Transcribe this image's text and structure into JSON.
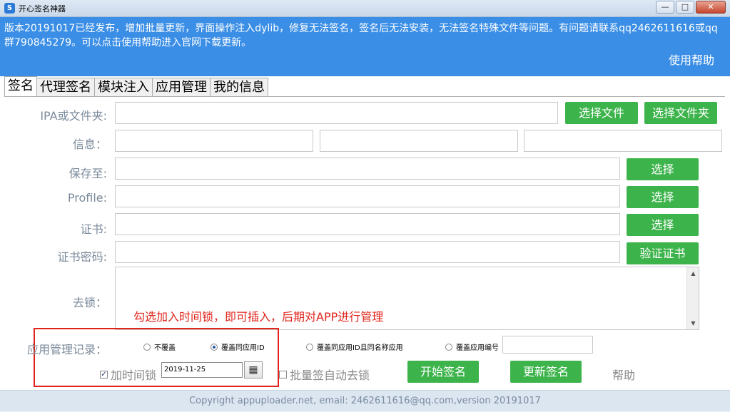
{
  "window": {
    "title": "开心签名神器",
    "icon_name": "app-icon",
    "minimize_glyph": "—",
    "maximize_glyph": "□",
    "close_glyph": "✕"
  },
  "notice": {
    "text": "版本20191017已经发布，增加批量更新，界面操作注入dylib，修复无法签名，签名后无法安装，无法签名特殊文件等问题。有问题请联系qq2462611616或qq群790845279。可以点击使用帮助进入官网下载更新。",
    "help_label": "使用帮助"
  },
  "tabs": [
    {
      "label": "签名",
      "active": true
    },
    {
      "label": "代理签名",
      "active": false
    },
    {
      "label": "模块注入",
      "active": false
    },
    {
      "label": "应用管理",
      "active": false
    },
    {
      "label": "我的信息",
      "active": false
    }
  ],
  "form": {
    "ipa_label": "IPA或文件夹:",
    "select_file_button": "选择文件",
    "select_folder_button": "选择文件夹",
    "info_label": "信息：",
    "save_label": "保存至:",
    "save_select_button": "选择",
    "profile_label": "Profile:",
    "profile_select_button": "选择",
    "cert_label": "证书:",
    "cert_select_button": "选择",
    "cert_password_label": "证书密码:",
    "verify_cert_button": "验证证书",
    "remove_lock_label": "去锁："
  },
  "annotation": {
    "red_note": "勾选加入时间锁，即可插入，后期对APP进行管理"
  },
  "app_record": {
    "label": "应用管理记录：",
    "options": [
      {
        "label": "不覆盖",
        "selected": false
      },
      {
        "label": "覆盖同应用ID",
        "selected": true
      },
      {
        "label": "覆盖同应用ID且同名称应用",
        "selected": false
      },
      {
        "label": "覆盖应用编号",
        "selected": false
      }
    ]
  },
  "bottom_row": {
    "time_lock_label": "加时间锁",
    "time_lock_checked": true,
    "date_value": "2019-11-25",
    "batch_unlock_label": "批量签自动去锁",
    "batch_unlock_checked": false,
    "start_sign_button": "开始签名",
    "update_sign_button": "更新签名",
    "help_label": "帮助"
  },
  "footer": {
    "text": "Copyright appuploader.net, email: 2462611616@qq.com,version 20191017"
  },
  "colors": {
    "notice_bg": "#3a8ee6",
    "button_green": "#3db44b",
    "annotation_red": "#e0241b"
  }
}
